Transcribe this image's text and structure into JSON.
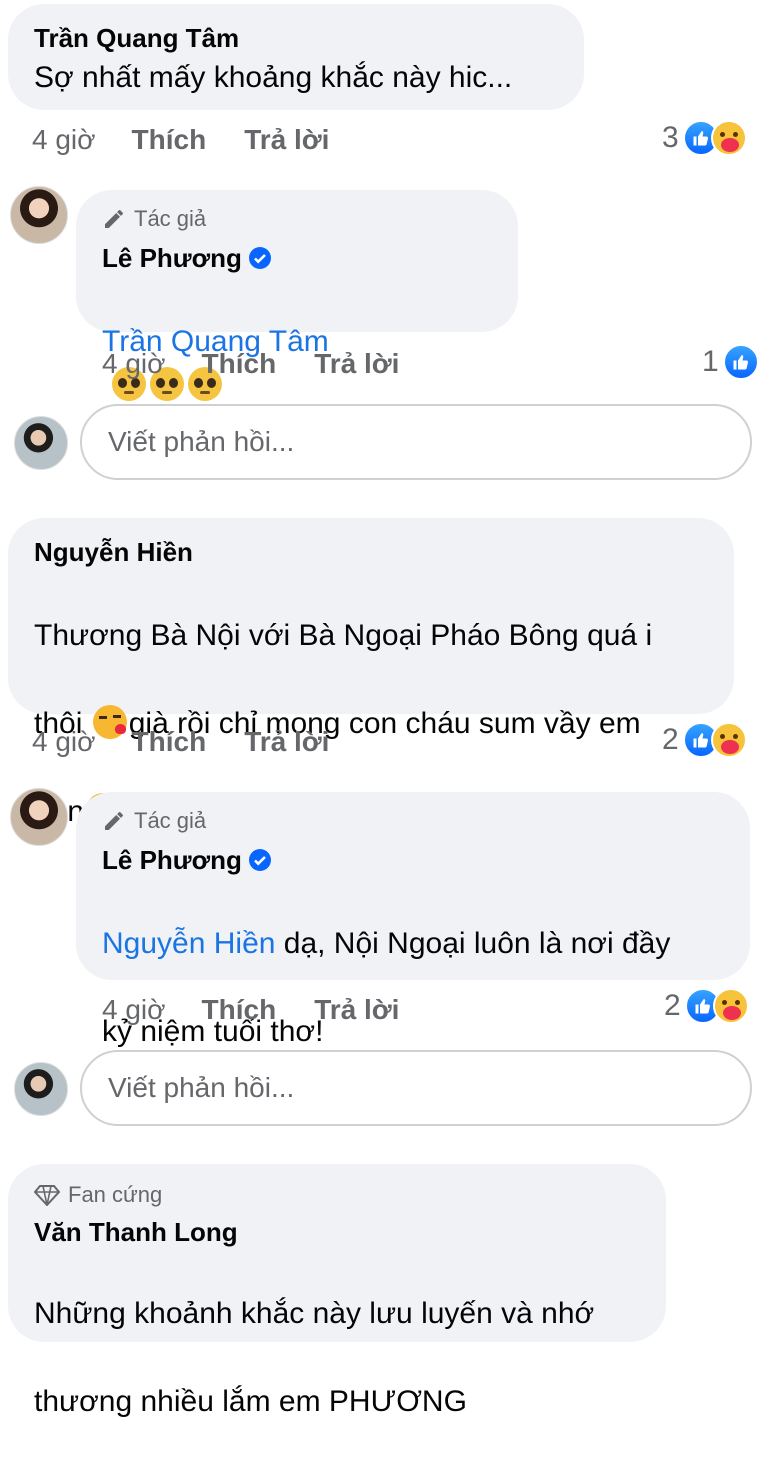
{
  "comments": [
    {
      "author": "Trần Quang Tâm",
      "text": "Sợ nhất mấy khoảng khắc này hic...",
      "time": "4 giờ",
      "like_label": "Thích",
      "reply_label": "Trả lời",
      "reaction_count": "3",
      "reactions": [
        "like-icon",
        "care-icon"
      ]
    },
    {
      "badge": "Tác giả",
      "author": "Lê Phương",
      "mention": "Trần Quang Tâm",
      "emojis": [
        "pleading-face",
        "pleading-face",
        "pleading-face"
      ],
      "time": "4 giờ",
      "like_label": "Thích",
      "reply_label": "Trả lời",
      "reaction_count": "1",
      "reactions": [
        "like-icon"
      ]
    },
    {
      "author": "Nguyễn Hiền",
      "text_line1": "Thương Bà Nội với Bà Ngoại Pháo Bông quá i",
      "text_line2a": "thôi ",
      "text_line2b": "già rồi chỉ mong con cháu sum vầy em",
      "text_line3": "hen",
      "time": "4 giờ",
      "like_label": "Thích",
      "reply_label": "Trả lời",
      "reaction_count": "2",
      "reactions": [
        "like-icon",
        "care-icon"
      ]
    },
    {
      "badge": "Tác giả",
      "author": "Lê Phương",
      "mention": "Nguyễn Hiền",
      "text_line1": " dạ, Nội Ngoại luôn là nơi đầy",
      "text_line2": "kỷ niệm tuổi thơ!",
      "time": "4 giờ",
      "like_label": "Thích",
      "reply_label": "Trả lời",
      "reaction_count": "2",
      "reactions": [
        "like-icon",
        "care-icon"
      ]
    },
    {
      "badge": "Fan cứng",
      "author": "Văn Thanh Long",
      "text_line1": "Những khoảnh khắc này lưu luyến và nhớ",
      "text_line2": "thương nhiều lắm em PHƯƠNG"
    }
  ],
  "reply_inputs": [
    {
      "placeholder": "Viết phản hồi..."
    },
    {
      "placeholder": "Viết phản hồi..."
    }
  ],
  "colors": {
    "bubble": "#f0f2f5",
    "mention": "#1b74e4",
    "meta": "#65676b",
    "like": "#0866ff"
  }
}
